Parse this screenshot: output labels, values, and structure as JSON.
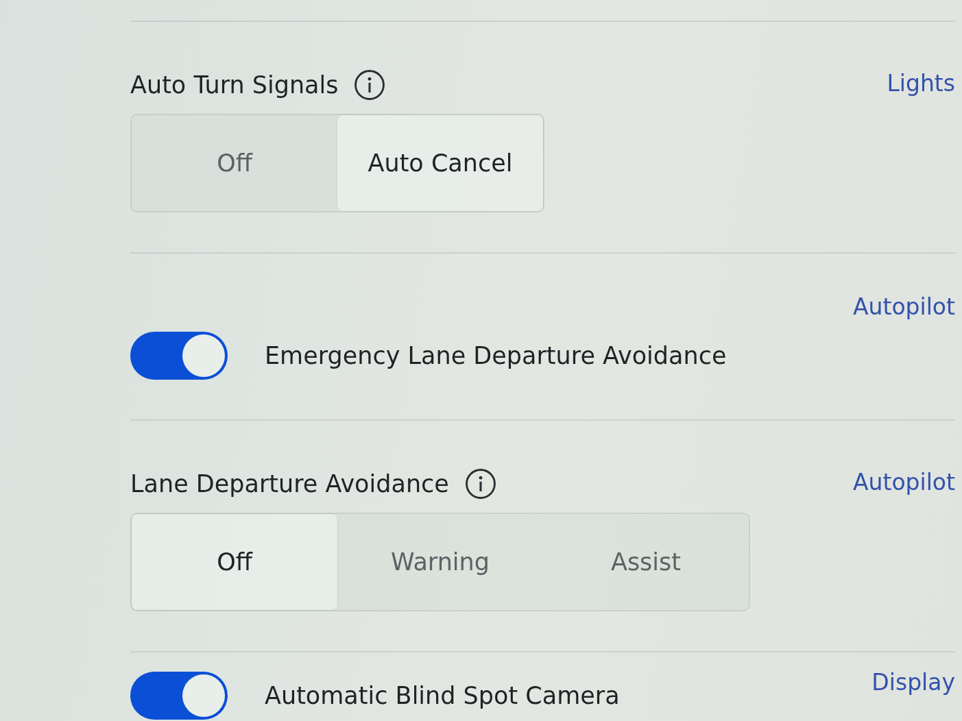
{
  "settings": [
    {
      "kind": "segmented",
      "title": "Auto Turn Signals",
      "info": true,
      "options": [
        {
          "label": "Off",
          "selected": false
        },
        {
          "label": "Auto Cancel",
          "selected": true
        }
      ],
      "link": "Lights"
    },
    {
      "kind": "toggle",
      "title": "Emergency Lane Departure Avoidance",
      "on": true,
      "link": "Autopilot"
    },
    {
      "kind": "segmented",
      "title": "Lane Departure Avoidance",
      "info": true,
      "options": [
        {
          "label": "Off",
          "selected": true
        },
        {
          "label": "Warning",
          "selected": false
        },
        {
          "label": "Assist",
          "selected": false
        }
      ],
      "link": "Autopilot"
    },
    {
      "kind": "toggle",
      "title": "Automatic Blind Spot Camera",
      "on": true,
      "link": "Display"
    }
  ]
}
